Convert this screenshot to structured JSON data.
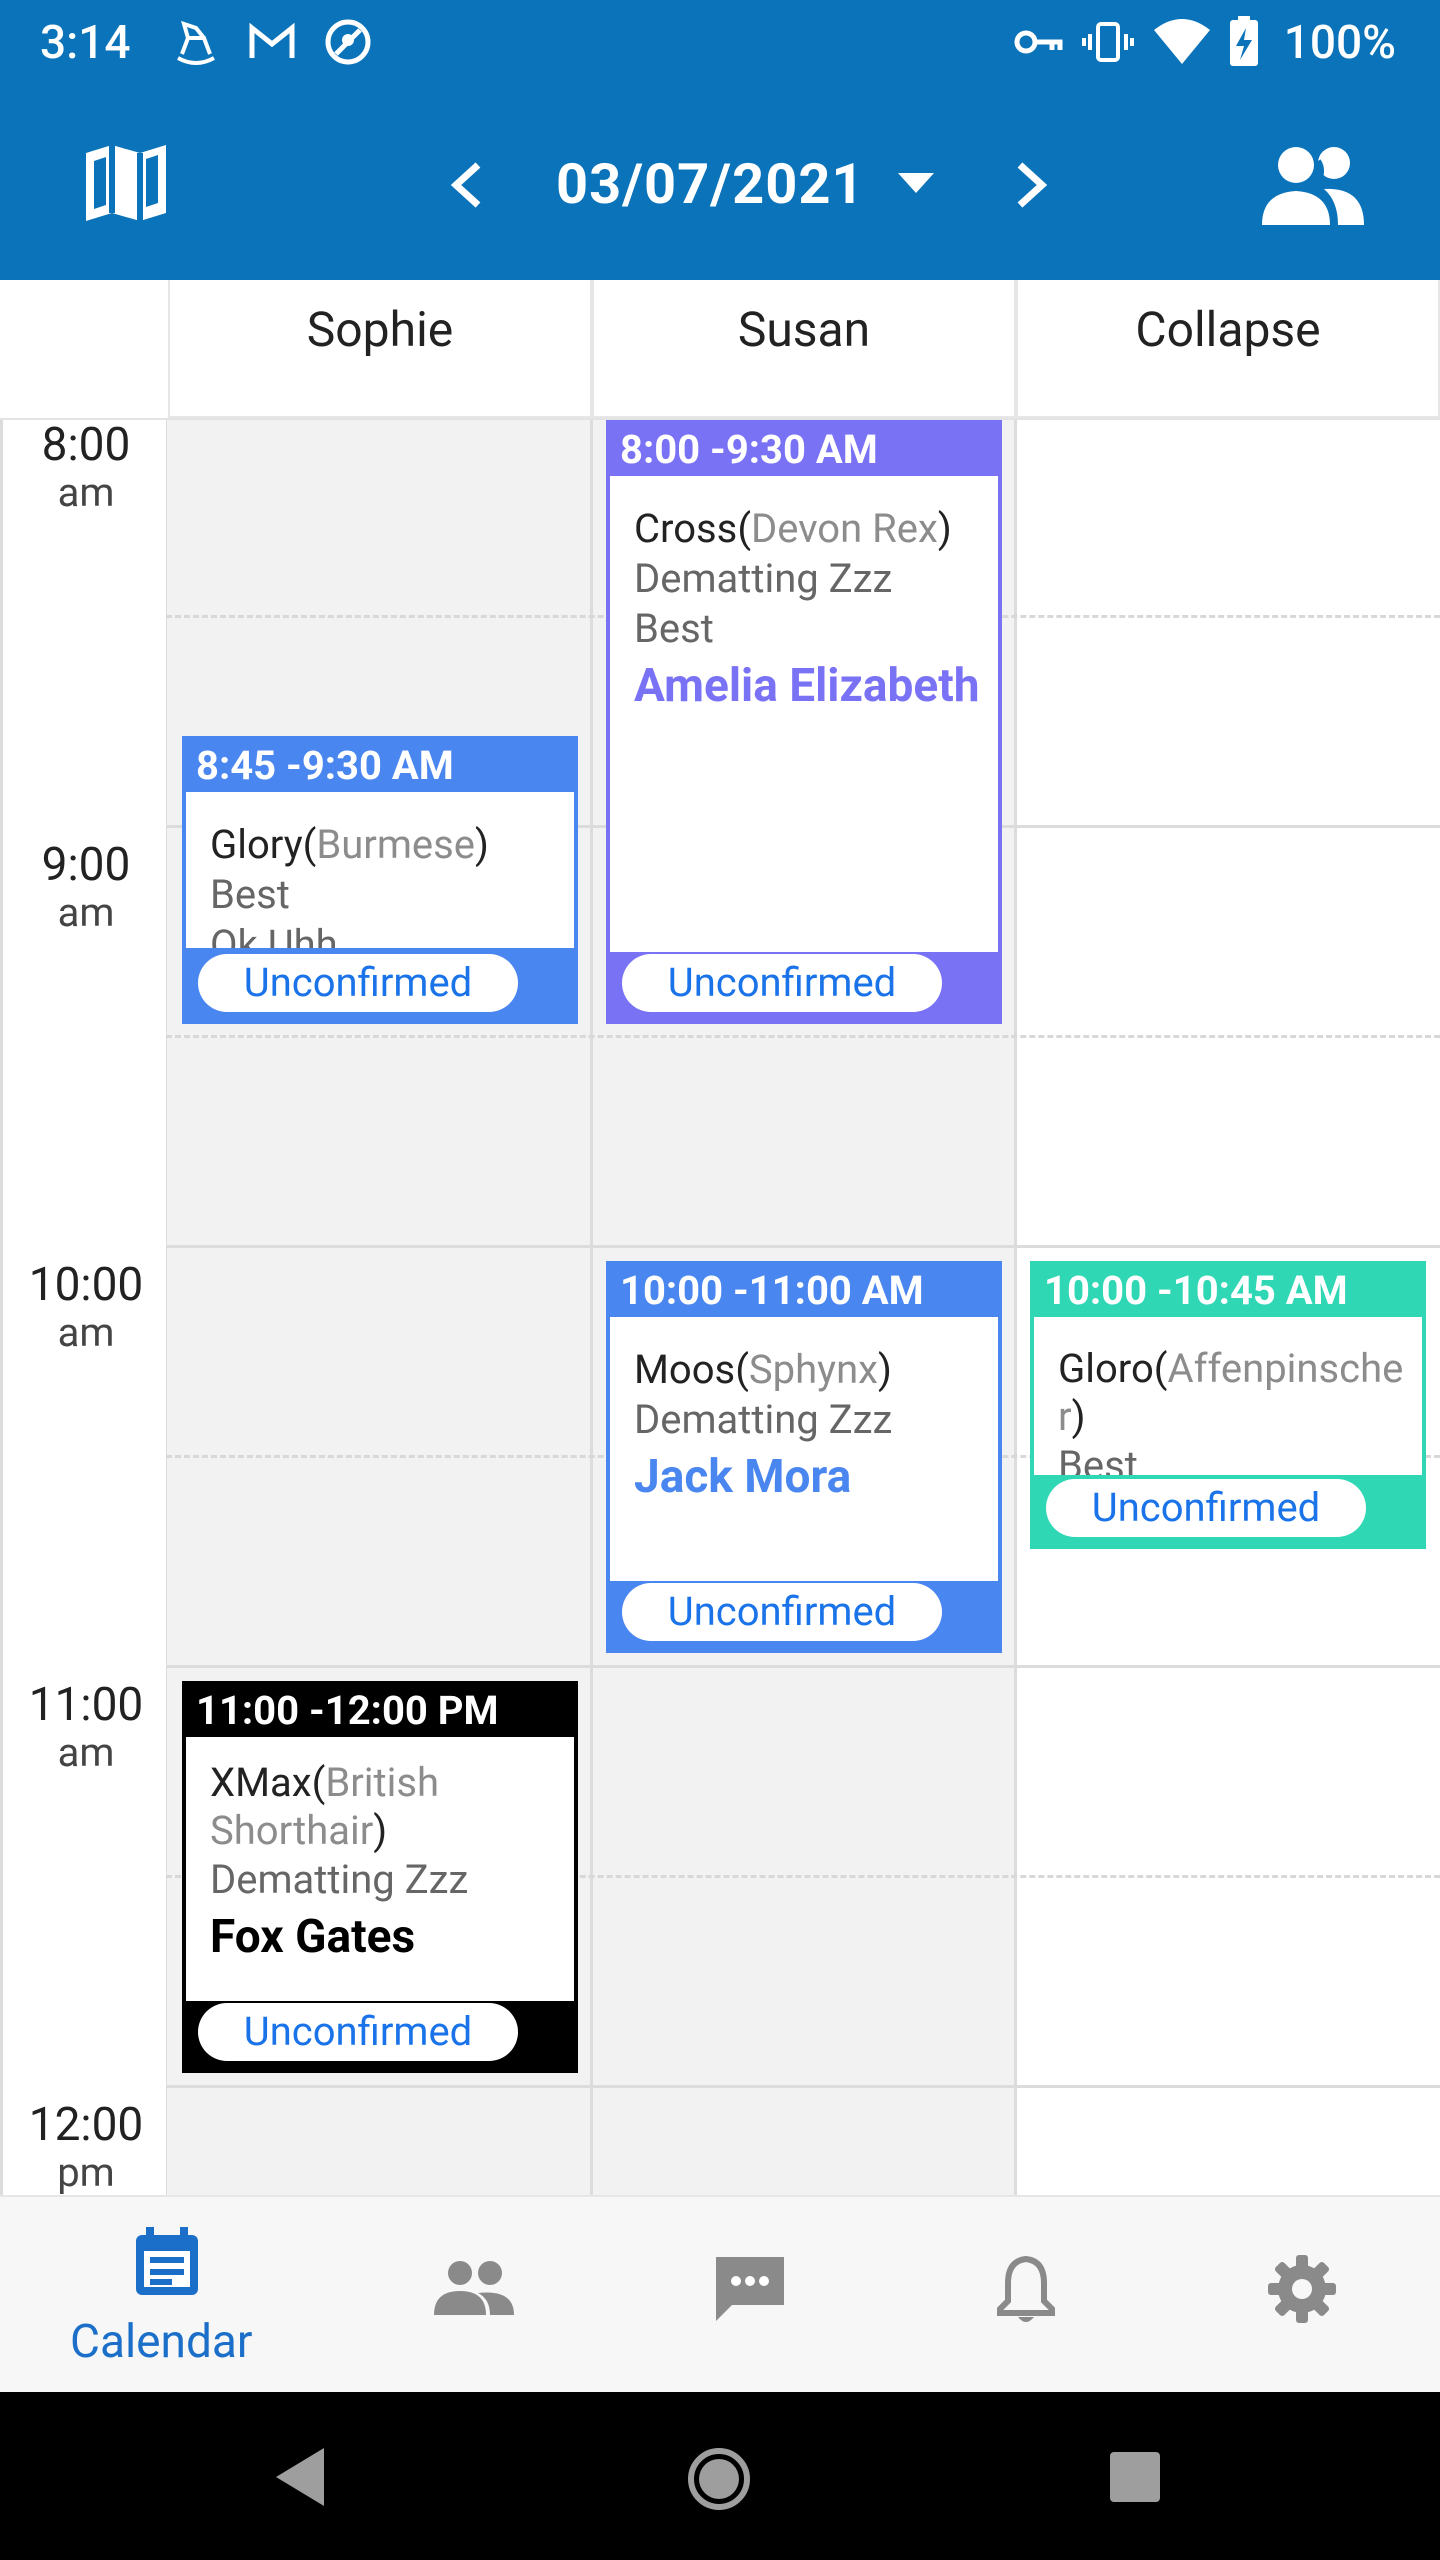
{
  "status_bar": {
    "time": "3:14",
    "battery": "100%"
  },
  "header": {
    "date": "03/07/2021"
  },
  "columns": [
    {
      "label": "Sophie"
    },
    {
      "label": "Susan"
    },
    {
      "label": "Collapse"
    }
  ],
  "time_labels": [
    {
      "hour": "8:00",
      "meridiem": "am"
    },
    {
      "hour": "9:00",
      "meridiem": "am"
    },
    {
      "hour": "10:00",
      "meridiem": "am"
    },
    {
      "hour": "11:00",
      "meridiem": "am"
    },
    {
      "hour": "12:00",
      "meridiem": "pm"
    }
  ],
  "appointments": [
    {
      "time": "8:45 -9:30 AM",
      "pet": "Glory",
      "breed": "Burmese",
      "service": "Best",
      "extra": "Ok Uhh",
      "status": "Unconfirmed"
    },
    {
      "time": "8:00 -9:30 AM",
      "pet": "Cross",
      "breed": "Devon Rex",
      "service": "Dematting Zzz",
      "service2": "Best",
      "customer": "Amelia Elizabeth",
      "status": "Unconfirmed"
    },
    {
      "time": "10:00 -11:00 AM",
      "pet": "Moos",
      "breed": "Sphynx",
      "service": "Dematting Zzz",
      "customer": "Jack Mora",
      "status": "Unconfirmed"
    },
    {
      "time": "10:00 -10:45 AM",
      "pet": "Gloro",
      "breed": "Affenpinscher",
      "service": "Best",
      "status": "Unconfirmed"
    },
    {
      "time": "11:00 -12:00 PM",
      "pet": "XMax",
      "breed": "British Shorthair",
      "service": "Dematting Zzz",
      "customer": "Fox Gates",
      "status": "Unconfirmed"
    }
  ],
  "colors": {
    "primary": "#0a73b9",
    "blue": "#4a86f0",
    "purple": "#7a72f5",
    "teal": "#2fd7b4",
    "black": "#000000",
    "link": "#1a73e8"
  },
  "bottom_nav": [
    {
      "icon": "calendar-icon",
      "label": "Calendar",
      "active": true
    },
    {
      "icon": "people-icon"
    },
    {
      "icon": "chat-icon"
    },
    {
      "icon": "bell-icon"
    },
    {
      "icon": "gear-icon"
    }
  ]
}
